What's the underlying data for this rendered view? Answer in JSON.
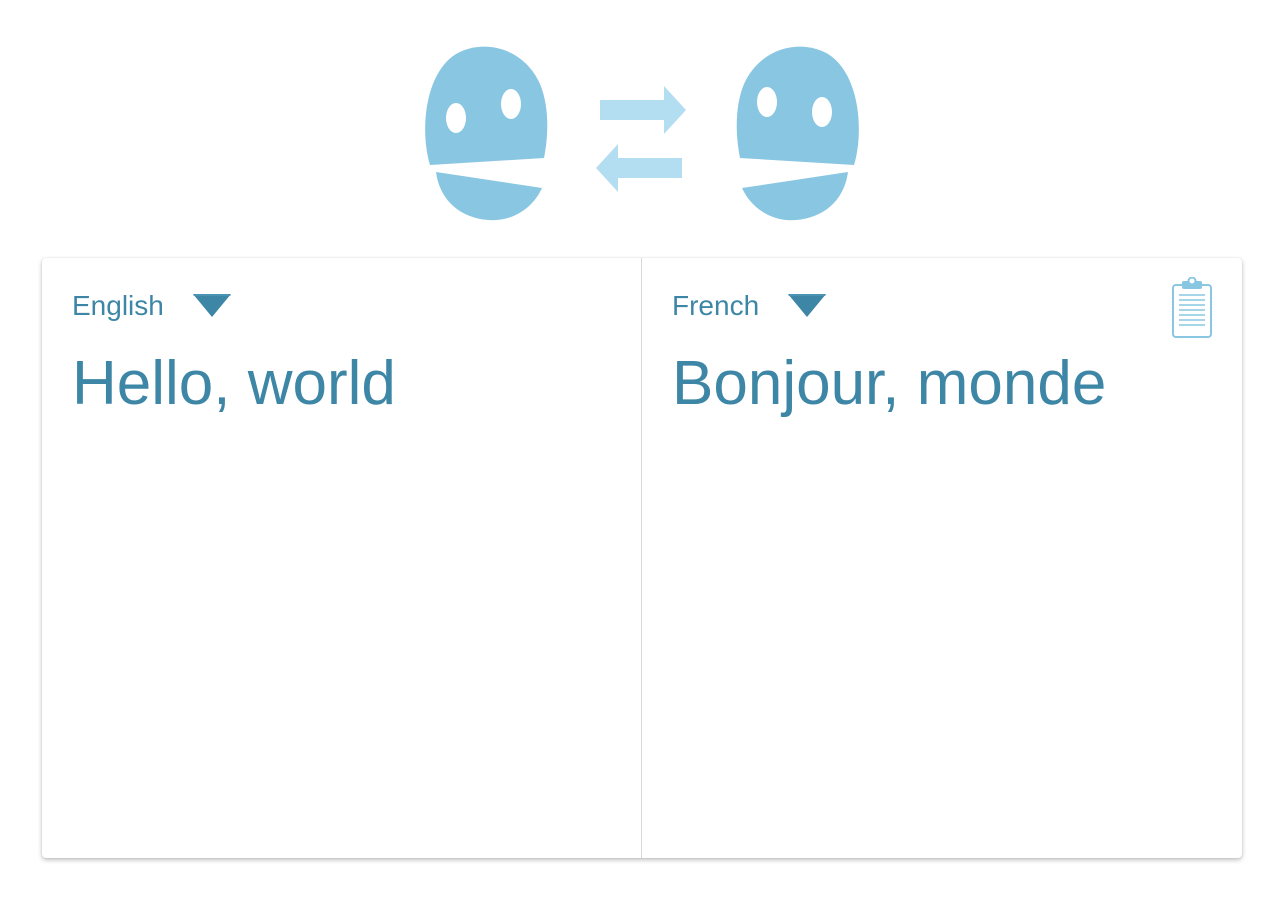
{
  "source": {
    "language": "English",
    "text": "Hello, world"
  },
  "target": {
    "language": "French",
    "text": "Bonjour, monde"
  },
  "icons": {
    "logo": "two-talking-heads-swap-icon",
    "dropdown": "triangle-down-icon",
    "copy": "clipboard-icon"
  },
  "colors": {
    "accent": "#3d86a6",
    "logo_blue": "#89c6e2",
    "arrow_blue": "#b3def2"
  }
}
